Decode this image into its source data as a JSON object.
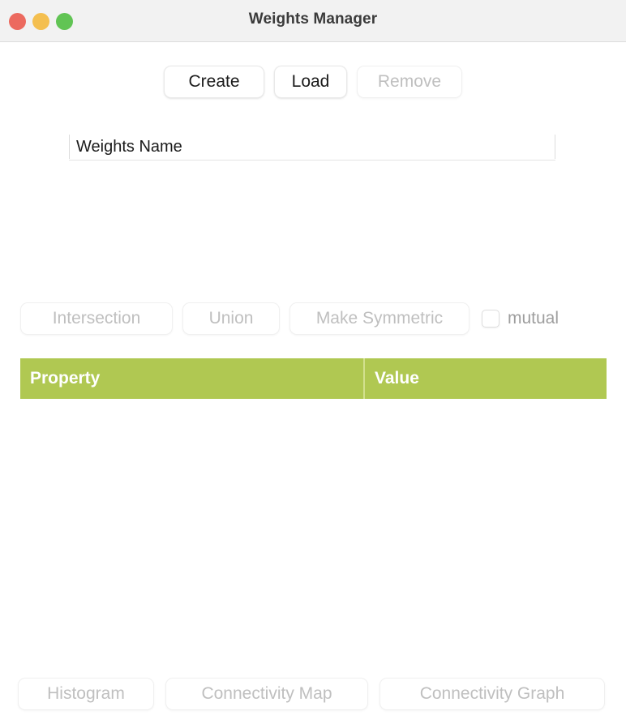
{
  "window": {
    "title": "Weights Manager",
    "traffic_lights": [
      {
        "name": "close",
        "color": "#ec6a5f"
      },
      {
        "name": "minimize",
        "color": "#f4bf4f"
      },
      {
        "name": "maximize",
        "color": "#61c454"
      }
    ]
  },
  "top_actions": {
    "create": {
      "label": "Create",
      "enabled": true
    },
    "load": {
      "label": "Load",
      "enabled": true
    },
    "remove": {
      "label": "Remove",
      "enabled": false
    }
  },
  "name_field": {
    "label": "Weights Name",
    "value": "",
    "placeholder": "Weights Name"
  },
  "set_operations": {
    "intersection": {
      "label": "Intersection",
      "enabled": false
    },
    "union": {
      "label": "Union",
      "enabled": false
    },
    "make_symmetric": {
      "label": "Make Symmetric",
      "enabled": false
    },
    "mutual": {
      "label": "mutual",
      "checked": false
    }
  },
  "table": {
    "accent_color": "#b0c852",
    "columns": [
      "Property",
      "Value"
    ],
    "rows": []
  },
  "bottom_actions": {
    "histogram": {
      "label": "Histogram",
      "enabled": false
    },
    "connectivity_map": {
      "label": "Connectivity Map",
      "enabled": false
    },
    "connectivity_graph": {
      "label": "Connectivity Graph",
      "enabled": false
    }
  }
}
